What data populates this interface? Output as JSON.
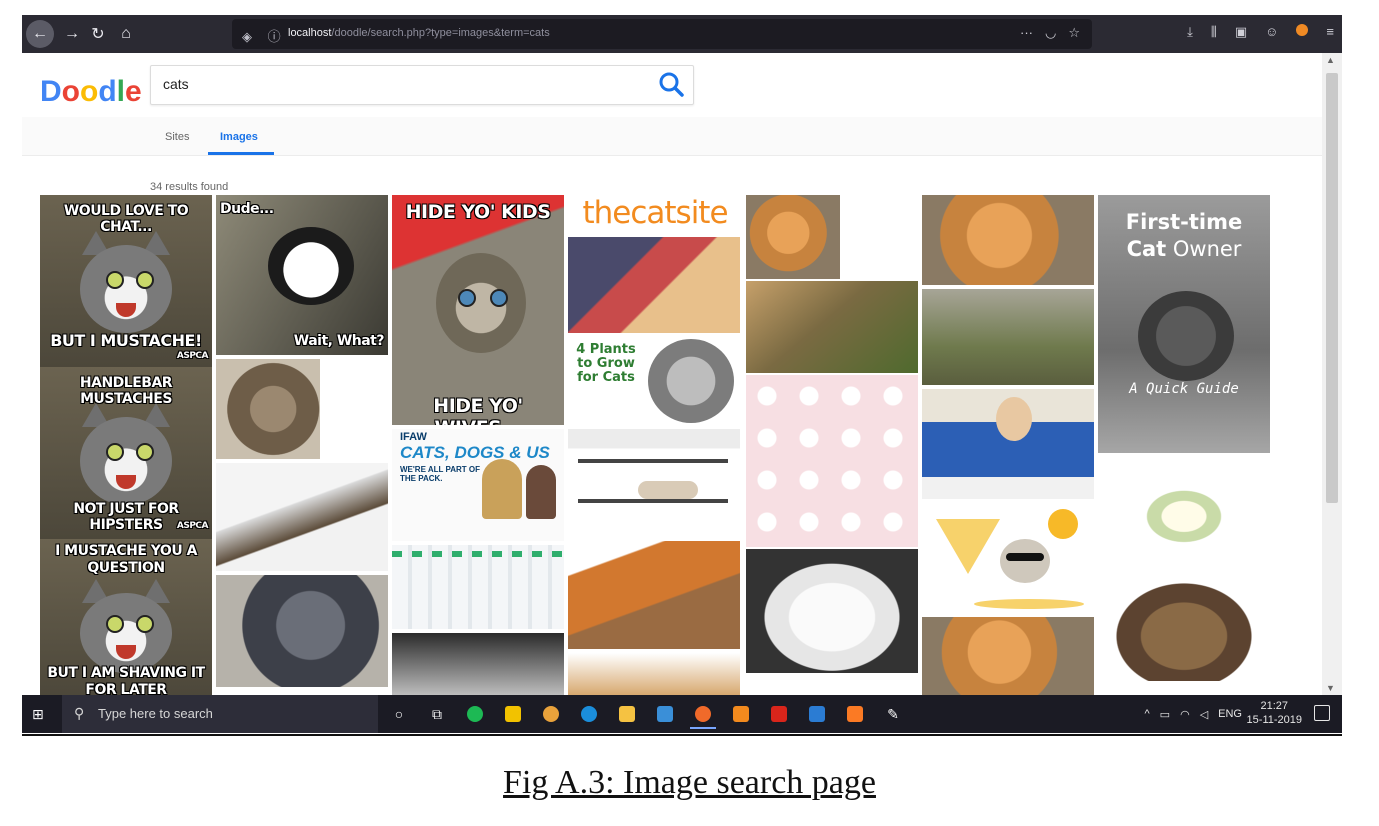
{
  "browser": {
    "url_host": "localhost",
    "url_path": "/doodle/search.php?type=images&term=cats",
    "url_action_icons": [
      "more-icon",
      "pocket-icon",
      "bookmark-star-icon"
    ],
    "toolbar_icons": [
      "download-icon",
      "library-icon",
      "sidebar-icon",
      "account-icon",
      "extension-icon",
      "menu-icon"
    ]
  },
  "site": {
    "logo": [
      "D",
      "o",
      "o",
      "d",
      "l",
      "e"
    ],
    "logo_colors": [
      "#4285f4",
      "#ea4335",
      "#fbbc05",
      "#4285f4",
      "#34a853",
      "#ea4335"
    ],
    "search_value": "cats",
    "tabs": [
      "Sites",
      "Images"
    ],
    "active_tab": "Images",
    "result_count": "34 results found",
    "accent_color": "#1a73e8"
  },
  "images": {
    "meme1_top": "WOULD LOVE TO CHAT...",
    "meme1_bottom": "BUT I MUSTACHE!",
    "meme1_credit": "ASPCA",
    "meme2_top": "HANDLEBAR MUSTACHES",
    "meme2_bottom": "NOT JUST FOR HIPSTERS",
    "meme2_credit": "ASPCA",
    "meme3_top": "I MUSTACHE YOU A QUESTION",
    "meme3_bottom": "BUT I AM SHAVING IT FOR LATER",
    "dude_top": "Dude...",
    "dude_bottom": "Wait, What?",
    "kids_top": "HIDE YO' KIDS",
    "kids_bottom": "HIDE YO' WIVES...",
    "catsite_logo": "thecatsite",
    "plants_text": "4 Plants to Grow for Cats",
    "ifaw_logo": "IFAW",
    "ifaw_title": "CATS, DOGS & US",
    "ifaw_sub": "WE'RE ALL PART OF THE PACK.",
    "guide_line1": "First-time",
    "guide_line2_bold": "Cat",
    "guide_line2_rest": " Owner",
    "guide_sub": "A Quick Guide"
  },
  "taskbar": {
    "search_placeholder": "Type here to search",
    "language": "ENG",
    "time": "21:27",
    "date": "15-11-2019"
  },
  "caption": "Fig A.3: Image search page"
}
